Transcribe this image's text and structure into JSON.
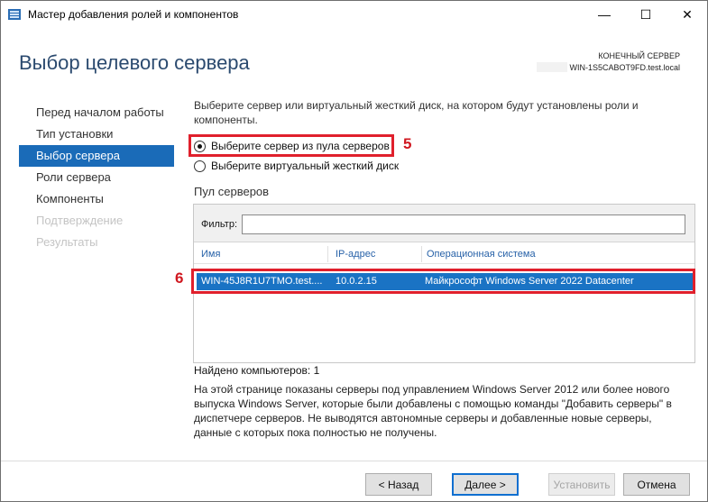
{
  "window": {
    "title": "Мастер добавления ролей и компонентов",
    "minimize_glyph": "—",
    "maximize_glyph": "☐",
    "close_glyph": "✕"
  },
  "header": {
    "title": "Выбор целевого сервера",
    "dest_label": "КОНЕЧНЫЙ СЕРВЕР",
    "dest_server": "WIN-1S5CABOT9FD.test.local"
  },
  "nav": {
    "items": [
      {
        "label": "Перед началом работы",
        "state": "normal"
      },
      {
        "label": "Тип установки",
        "state": "normal"
      },
      {
        "label": "Выбор сервера",
        "state": "active"
      },
      {
        "label": "Роли сервера",
        "state": "normal"
      },
      {
        "label": "Компоненты",
        "state": "normal"
      },
      {
        "label": "Подтверждение",
        "state": "disabled"
      },
      {
        "label": "Результаты",
        "state": "disabled"
      }
    ]
  },
  "content": {
    "description": "Выберите сервер или виртуальный жесткий диск, на котором будут установлены роли и компоненты.",
    "radio_pool": "Выберите сервер из пула серверов",
    "radio_vhd": "Выберите виртуальный жесткий диск",
    "marker_5": "5",
    "marker_6": "6",
    "pool_title": "Пул серверов",
    "filter_label": "Фильтр:",
    "filter_value": "",
    "columns": {
      "name": "Имя",
      "ip": "IP-адрес",
      "os": "Операционная система"
    },
    "rows": [
      {
        "name": "WIN-45J8R1U7TMO.test....",
        "ip": "10.0.2.15",
        "os": "Майкрософт Windows Server 2022 Datacenter"
      }
    ],
    "found": "Найдено компьютеров: 1",
    "note": "На этой странице показаны серверы под управлением Windows Server 2012 или более нового выпуска Windows Server, которые были добавлены с помощью команды \"Добавить серверы\" в диспетчере серверов. Не выводятся автономные серверы и добавленные новые серверы, данные с которых пока полностью не получены."
  },
  "buttons": {
    "back": "< Назад",
    "next": "Далее >",
    "install": "Установить",
    "cancel": "Отмена"
  },
  "colors": {
    "accent": "#1a6bb8",
    "selection": "#1a73c4",
    "highlight": "#e0202c",
    "title_text": "#2b4a6f"
  }
}
